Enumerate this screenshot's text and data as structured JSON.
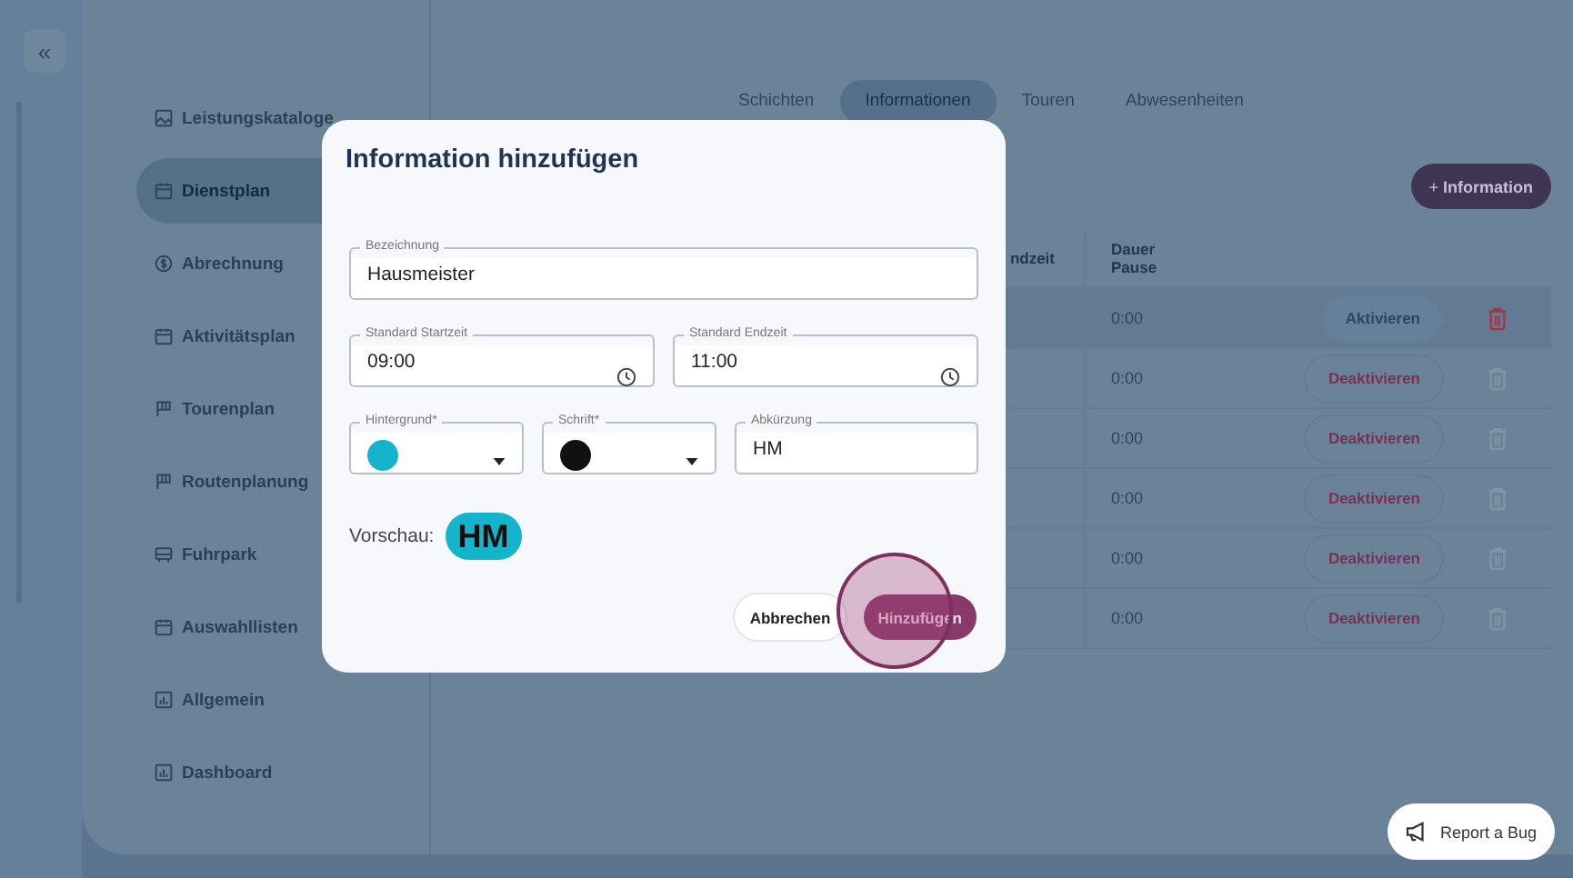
{
  "sidebar": {
    "collapse": "«",
    "items": [
      {
        "label": "Leistungskataloge",
        "selected": false
      },
      {
        "label": "Dienstplan",
        "selected": true
      },
      {
        "label": "Abrechnung",
        "selected": false
      },
      {
        "label": "Aktivitätsplan",
        "selected": false
      },
      {
        "label": "Tourenplan",
        "selected": false
      },
      {
        "label": "Routenplanung",
        "selected": false
      },
      {
        "label": "Fuhrpark",
        "selected": false
      },
      {
        "label": "Auswahllisten",
        "selected": false
      },
      {
        "label": "Allgemein",
        "selected": false
      },
      {
        "label": "Dashboard",
        "selected": false
      }
    ]
  },
  "tabs": [
    {
      "label": "Schichten",
      "selected": false
    },
    {
      "label": "Informationen",
      "selected": true
    },
    {
      "label": "Touren",
      "selected": false
    },
    {
      "label": "Abwesenheiten",
      "selected": false
    }
  ],
  "add_button": {
    "plus": "+",
    "label": "Information"
  },
  "table": {
    "columns": [
      "ndzeit",
      "Dauer Pause"
    ],
    "rows": [
      {
        "pause": "0:00",
        "action": "Aktivieren",
        "kind": "activate",
        "hovered": true
      },
      {
        "pause": "0:00",
        "action": "Deaktivieren",
        "kind": "deactivate",
        "hovered": false
      },
      {
        "pause": "0:00",
        "action": "Deaktivieren",
        "kind": "deactivate",
        "hovered": false
      },
      {
        "pause": "0:00",
        "action": "Deaktivieren",
        "kind": "deactivate",
        "hovered": false
      },
      {
        "pause": "0:00",
        "action": "Deaktivieren",
        "kind": "deactivate",
        "hovered": false
      },
      {
        "pause": "0:00",
        "action": "Deaktivieren",
        "kind": "deactivate",
        "hovered": false
      }
    ]
  },
  "dialog": {
    "title": "Information hinzufügen",
    "name": {
      "label": "Bezeichnung",
      "value": "Hausmeister"
    },
    "start": {
      "label": "Standard Startzeit",
      "value": "09:00"
    },
    "end": {
      "label": "Standard Endzeit",
      "value": "11:00"
    },
    "background": {
      "label": "Hintergrund*",
      "color": "#14b4cc"
    },
    "font": {
      "label": "Schrift*",
      "color": "#111111"
    },
    "abbr": {
      "label": "Abkürzung",
      "value": "HM"
    },
    "preview_label": "Vorschau:",
    "preview": "HM",
    "cancel": "Abbrechen",
    "submit": "Hinzufügen"
  },
  "report_bug": "Report a Bug"
}
